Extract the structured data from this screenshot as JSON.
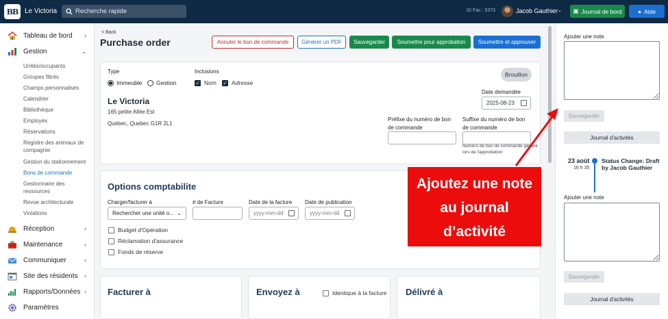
{
  "header": {
    "logo_text": "BB",
    "app_name": "Le Victoria",
    "search_placeholder": "Recherche rapide",
    "id_fac": "ID Fac : 5373",
    "user_name": "Jacob Gauthier",
    "journal_button": "Journal de bord",
    "help_button": "Aide"
  },
  "sidebar": {
    "items": [
      {
        "label": "Tableau de bord",
        "icon": "home-icon"
      },
      {
        "label": "Gestion",
        "icon": "chart-icon"
      },
      {
        "label": "Réception",
        "icon": "bell-icon"
      },
      {
        "label": "Maintenance",
        "icon": "toolbox-icon"
      },
      {
        "label": "Communiquer",
        "icon": "mail-icon"
      },
      {
        "label": "Site des résidents",
        "icon": "website-icon"
      },
      {
        "label": "Rapports/Données",
        "icon": "bar-chart-icon"
      },
      {
        "label": "Paramètres",
        "icon": "gear-icon"
      }
    ],
    "subitems": [
      "Unités/occupants",
      "Groupes filtrés",
      "Champs personnalisés",
      "Calendrier",
      "Bibliothèque",
      "Employés",
      "Réservations",
      "Registre des animaux de compagnie",
      "Gestion du stationnement",
      "Bons de commande",
      "Gestionnaire des ressources",
      "Revue architecturale",
      "Violations"
    ]
  },
  "page": {
    "back": "< Back",
    "title": "Purchase order",
    "buttons": {
      "cancel": "Annuler le bon de commande",
      "pdf": "Générer un PDF",
      "save": "Sauvegarder",
      "submit": "Soumettre pour approbation",
      "submit_approve": "Soumettre et approuver"
    }
  },
  "order": {
    "type_label": "Type",
    "type_options": [
      "Immeuble",
      "Gestion"
    ],
    "inclusions_label": "Inclusions",
    "inclusion_options": [
      "Nom",
      "Adresse"
    ],
    "status": "Brouillon",
    "property_name": "Le Victoria",
    "address_line1": "165 petite Allée Est",
    "address_line2": "Québec, Quebec G1R 2L1",
    "date_label": "Date demandée",
    "date_value": "2025-08-23",
    "prefix_label": "Préfixe du numéro de bon de commande",
    "suffix_label": "Suffixe du numéro de bon de commande",
    "help_text": "Numéro de bon de commande généré lors de l'approbation"
  },
  "accounting": {
    "title": "Options comptabilite",
    "charge_label": "Charger/facturer à",
    "charge_placeholder": "Rechercher une unité o...",
    "invoice_no_label": "# de Facture",
    "invoice_date_label": "Date de la facture",
    "publish_date_label": "Date de publication",
    "date_placeholder": "yyyy-mm-dd",
    "checks": [
      "Budget d'Opération",
      "Réclamation d'assurance",
      "Fonds de réserve"
    ]
  },
  "bottom": {
    "bill_to": "Facturer à",
    "ship_to": "Envoyez à",
    "same_as_invoice": "Identique à la facture",
    "deliver_to": "Délivré à"
  },
  "right_panel": {
    "add_note_label": "Ajouter une note",
    "save_button": "Sauvegarder",
    "journal_button": "Journal d'activités",
    "entry_date": "23 août",
    "entry_time": "16 h 35",
    "entry_text": "Status Change: Draft by Jacob Gauthier"
  },
  "annotation": {
    "text": "Ajoutez une note au journal d’activité",
    "color": "#ed0c0c"
  }
}
